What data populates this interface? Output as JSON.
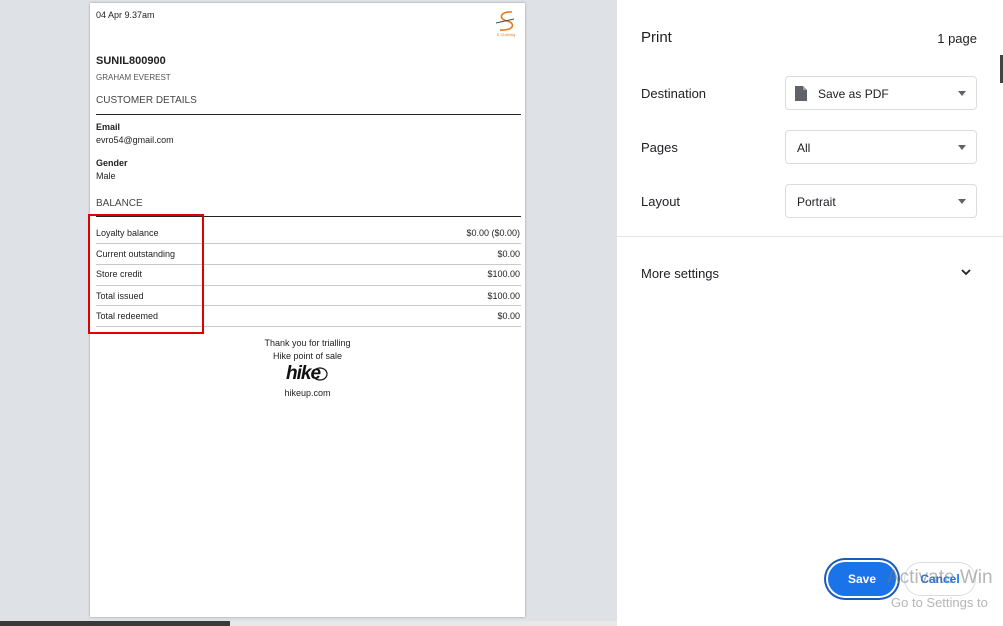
{
  "receipt": {
    "datetime": "04 Apr 9.37am",
    "logo_caption": "S Clothing",
    "customer_code": "SUNIL800900",
    "customer_name": "GRAHAM EVEREST",
    "customer_details_heading": "CUSTOMER DETAILS",
    "email_label": "Email",
    "email_value": "evro54@gmail.com",
    "gender_label": "Gender",
    "gender_value": "Male",
    "balance_heading": "BALANCE",
    "balance_rows": [
      {
        "label": "Loyalty balance",
        "value": "$0.00 ($0.00)"
      },
      {
        "label": "Current outstanding",
        "value": "$0.00"
      },
      {
        "label": "Store credit",
        "value": "$100.00"
      },
      {
        "label": "Total issued",
        "value": "$100.00"
      },
      {
        "label": "Total redeemed",
        "value": "$0.00"
      }
    ],
    "footer_line1": "Thank you for trialling",
    "footer_line2": "Hike point of sale",
    "footer_brand": "hike",
    "footer_url": "hikeup.com"
  },
  "print_panel": {
    "title": "Print",
    "page_count": "1 page",
    "destination_label": "Destination",
    "destination_value": "Save as PDF",
    "pages_label": "Pages",
    "pages_value": "All",
    "layout_label": "Layout",
    "layout_value": "Portrait",
    "more_settings": "More settings",
    "save_label": "Save",
    "cancel_label": "Cancel"
  },
  "watermark": {
    "line1": "Activate Win",
    "line2": "Go to Settings to"
  },
  "colors": {
    "accent": "#1a73e8",
    "highlight": "#e00000",
    "logo_orange": "#e8791f"
  }
}
